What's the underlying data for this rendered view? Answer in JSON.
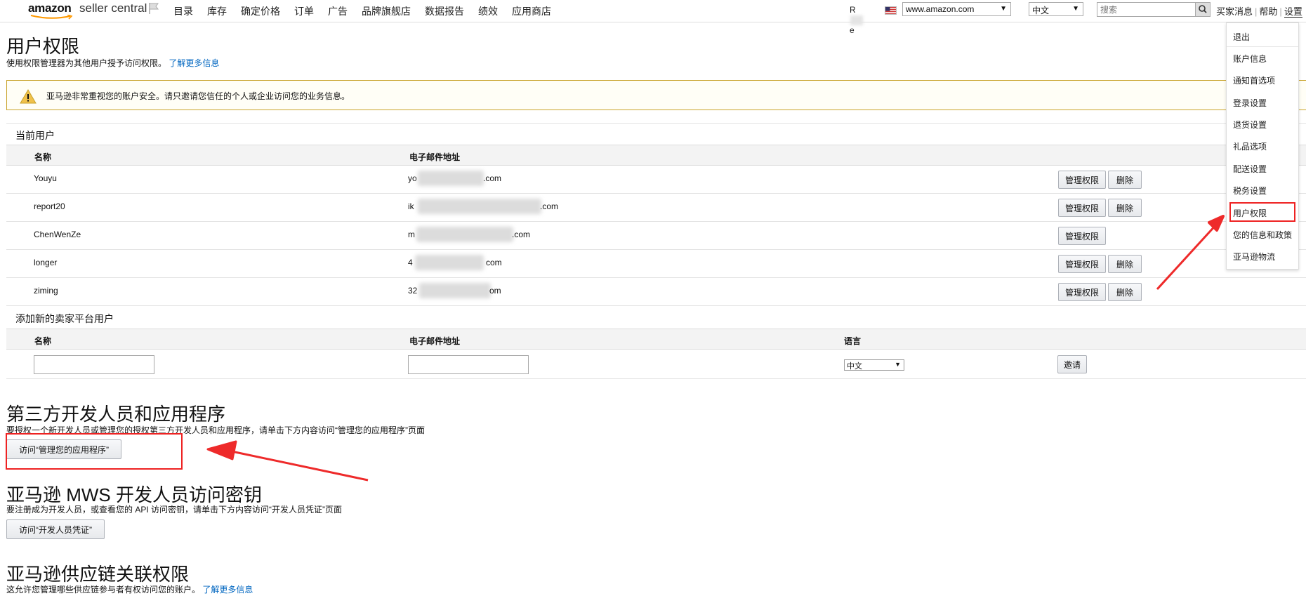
{
  "header": {
    "logo_brand": "amazon",
    "logo_suffix": "seller central",
    "nav": [
      "目录",
      "库存",
      "确定价格",
      "订单",
      "广告",
      "品牌旗舰店",
      "数据报告",
      "绩效",
      "应用商店"
    ],
    "account_partial": "R",
    "account_partial2": "e",
    "marketplace": "www.amazon.com",
    "language": "中文",
    "search_placeholder": "搜索",
    "links": {
      "messages": "买家消息",
      "help": "帮助",
      "settings": "设置"
    }
  },
  "settings_menu": [
    "退出",
    "账户信息",
    "通知首选项",
    "登录设置",
    "退货设置",
    "礼品选项",
    "配送设置",
    "税务设置",
    "用户权限",
    "您的信息和政策",
    "亚马逊物流"
  ],
  "page": {
    "title": "用户权限",
    "subtitle": "使用权限管理器为其他用户授予访问权限。",
    "learn_more": "了解更多信息",
    "alert": "亚马逊非常重视您的账户安全。请只邀请您信任的个人或企业访问您的业务信息。"
  },
  "current_users": {
    "title": "当前用户",
    "columns": {
      "name": "名称",
      "email": "电子邮件地址"
    },
    "rows": [
      {
        "name": "Youyu",
        "email_start": "yo",
        "email_end": ".com",
        "manage": "管理权限",
        "delete": "删除"
      },
      {
        "name": "report20",
        "email_start": "ik",
        "email_end": ".com",
        "manage": "管理权限",
        "delete": "删除"
      },
      {
        "name": "ChenWenZe",
        "email_start": "m",
        "email_end": ".com",
        "manage": "管理权限",
        "delete": ""
      },
      {
        "name": "longer",
        "email_start": "4",
        "email_end": "com",
        "manage": "管理权限",
        "delete": "删除"
      },
      {
        "name": "ziming",
        "email_start": "32",
        "email_end": "om",
        "manage": "管理权限",
        "delete": "删除"
      }
    ]
  },
  "add_user": {
    "title": "添加新的卖家平台用户",
    "columns": {
      "name": "名称",
      "email": "电子邮件地址",
      "language": "语言"
    },
    "language_value": "中文",
    "invite": "邀请"
  },
  "developers": {
    "title": "第三方开发人员和应用程序",
    "desc": "要授权一个新开发人员或管理您的授权第三方开发人员和应用程序，请单击下方内容访问“管理您的应用程序”页面",
    "button": "访问“管理您的应用程序”"
  },
  "mws": {
    "title": "亚马逊 MWS 开发人员访问密钥",
    "desc": "要注册成为开发人员，或查看您的 API 访问密钥，请单击下方内容访问“开发人员凭证”页面",
    "button": "访问“开发人员凭证”"
  },
  "supply_chain": {
    "title": "亚马逊供应链关联权限",
    "desc": "这允许您管理哪些供应链参与者有权访问您的账户。",
    "learn_more": "了解更多信息"
  }
}
